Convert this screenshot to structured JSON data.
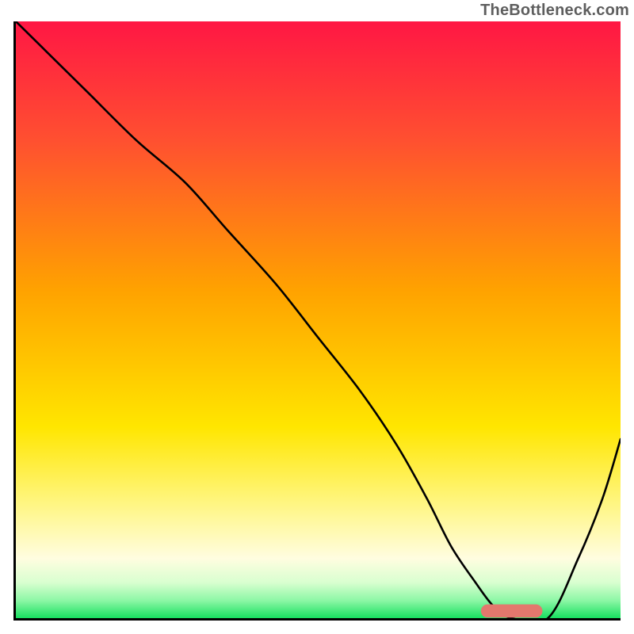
{
  "watermark": "TheBottleneck.com",
  "chart_data": {
    "type": "line",
    "title": "",
    "xlabel": "",
    "ylabel": "",
    "xlim": [
      0,
      100
    ],
    "ylim": [
      0,
      100
    ],
    "grid": false,
    "legend": false,
    "gradient_stops": [
      {
        "offset": 0,
        "color": "#ff1744"
      },
      {
        "offset": 20,
        "color": "#ff5030"
      },
      {
        "offset": 45,
        "color": "#ffa200"
      },
      {
        "offset": 68,
        "color": "#ffe600"
      },
      {
        "offset": 80,
        "color": "#fff57a"
      },
      {
        "offset": 90,
        "color": "#fffde0"
      },
      {
        "offset": 94,
        "color": "#d9ffd0"
      },
      {
        "offset": 97,
        "color": "#8ef7a6"
      },
      {
        "offset": 100,
        "color": "#18e060"
      }
    ],
    "series": [
      {
        "name": "curve",
        "x": [
          0,
          5,
          12,
          20,
          28,
          35,
          43,
          50,
          57,
          63,
          68,
          72,
          76,
          79,
          82,
          88,
          93,
          97,
          100
        ],
        "y": [
          100,
          95,
          88,
          80,
          73,
          65,
          56,
          47,
          38,
          29,
          20,
          12,
          6,
          2,
          0,
          0,
          10,
          20,
          30
        ]
      }
    ],
    "marker": {
      "name": "optimal-range-pill",
      "color": "#e3786d",
      "x_start": 78,
      "x_end": 86,
      "y": 1.2,
      "thickness_percent": 2.2
    }
  }
}
